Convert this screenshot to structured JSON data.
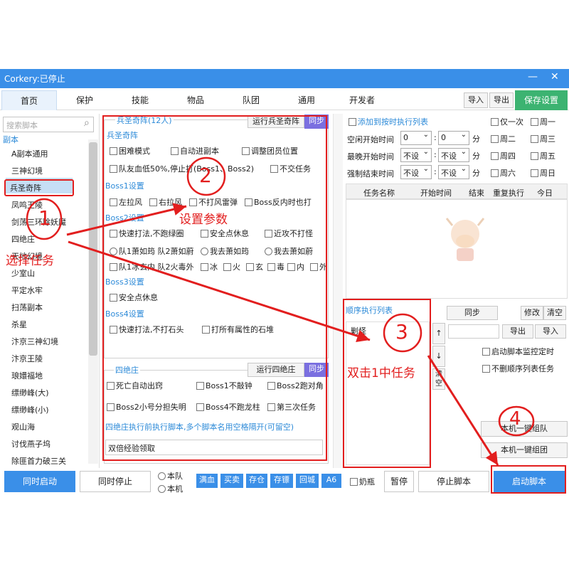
{
  "window": {
    "title": "Corkery:已停止",
    "minimize": "—",
    "close": "✕"
  },
  "tabs": [
    "首页",
    "保护",
    "技能",
    "物品",
    "队团",
    "通用",
    "开发者"
  ],
  "top_buttons": {
    "import": "导入",
    "export": "导出",
    "save": "保存设置"
  },
  "left": {
    "search_placeholder": "搜索脚本",
    "category": "副本",
    "items": [
      "A副本通用",
      "三神幻境",
      "兵圣奇阵",
      "凤鸣王陵",
      "剑荡三环除妖魔",
      "四绝庄",
      "天地幻境",
      "少室山",
      "平定水牢",
      "扫荡副本",
      "杀星",
      "汴京三神幻境",
      "汴京王陵",
      "琅嬛福地",
      "缥缈峰(大)",
      "缥缈峰(小)",
      "观山海",
      "讨伐燕子坞",
      "除匪首力破三关"
    ]
  },
  "mid": {
    "group1": {
      "legend": "兵圣奇阵(12人)",
      "run_btn": "运行兵圣奇阵",
      "sync_btn": "同步"
    },
    "title1": "兵圣奇阵",
    "o_kunnan": "困难模式",
    "o_auto": "自动进副本",
    "o_adjust": "调整团员位置",
    "o_hp": "队友血低50%,停止打(Boss1、Boss2)",
    "o_nojiao": "不交任务",
    "boss1": "Boss1设置",
    "b1_1": "左拉风",
    "b1_2": "右拉风",
    "b1_3": "不打风雷弹",
    "b1_4": "Boss反内时也打",
    "boss2": "Boss2设置",
    "b2_1": "快速打法,不跑绿圈",
    "b2_2": "安全点休息",
    "b2_3": "近攻不打怪",
    "r1": "队1萧如筠",
    "r1b": "队2萧如蔚",
    "r2": "我去萧如筠",
    "r3": "我去萧如蔚",
    "b2_4": "队1冰玄内",
    "b2_4b": "队2火毒外",
    "e1": "冰",
    "e2": "火",
    "e3": "玄",
    "e4": "毒",
    "e5": "内",
    "e6": "外",
    "boss3": "Boss3设置",
    "b3_1": "安全点休息",
    "boss4": "Boss4设置",
    "b4_1": "快速打法,不打石头",
    "b4_2": "打所有属性的石堆",
    "group2": {
      "legend": "四绝庄",
      "run_btn": "运行四绝庄",
      "sync_btn": "同步"
    },
    "s_1": "死亡自动出窍",
    "s_2": "Boss1不敲钟",
    "s_3": "Boss2跑对角",
    "s_4": "Boss2小号分担失明",
    "s_5": "Boss4不跑龙柱",
    "s_6": "第三次任务",
    "s_note": "四绝庄执行前执行脚本,多个脚本名用空格隔开(可留空)",
    "s_input": "双倍经验领取"
  },
  "right": {
    "timed_add": "添加到按时执行列表",
    "once": "仅一次",
    "weekdays": [
      "周一",
      "周二",
      "周三",
      "周四",
      "周五",
      "周六",
      "周日"
    ],
    "l1": "空闲开始时间",
    "l2": "最晚开始时间",
    "l3": "强制结束时间",
    "v_zero": "0",
    "v_unset": "不设",
    "unit_min": "分",
    "table_headers": [
      "任务名称",
      "开始时间",
      "结束",
      "重复执行",
      "今日"
    ],
    "seq_label": "顺序执行列表",
    "seq_sync": "同步",
    "seq_modify": "修改",
    "seq_clear": "清空",
    "seq_item": "剿怪",
    "up": "↑",
    "down": "↓",
    "clear_short": "清空",
    "ex": "导出",
    "im": "导入",
    "c1": "启动脚本监控定时",
    "c2": "不删顺序列表任务",
    "one_team": "本机一键组队",
    "one_group": "本机一键组团"
  },
  "bottom": {
    "sync_start": "同时启动",
    "sync_stop": "同时停止",
    "r_team": "本队",
    "r_machine": "本机",
    "actions": [
      "满血",
      "买卖",
      "存仓",
      "存镖",
      "回城",
      "A6"
    ],
    "milk": "奶瓶",
    "pause": "暂停",
    "stop": "停止脚本",
    "start": "启动脚本"
  },
  "annotations": {
    "n1": "1",
    "a1": "选择任务",
    "n2": "2",
    "a2": "设置参数",
    "n3": "3",
    "a3": "双击1中任务",
    "n4": "4"
  },
  "colors": {
    "accent": "#3a8fe8",
    "save": "#3cb371",
    "annotation": "#e21e1e"
  }
}
